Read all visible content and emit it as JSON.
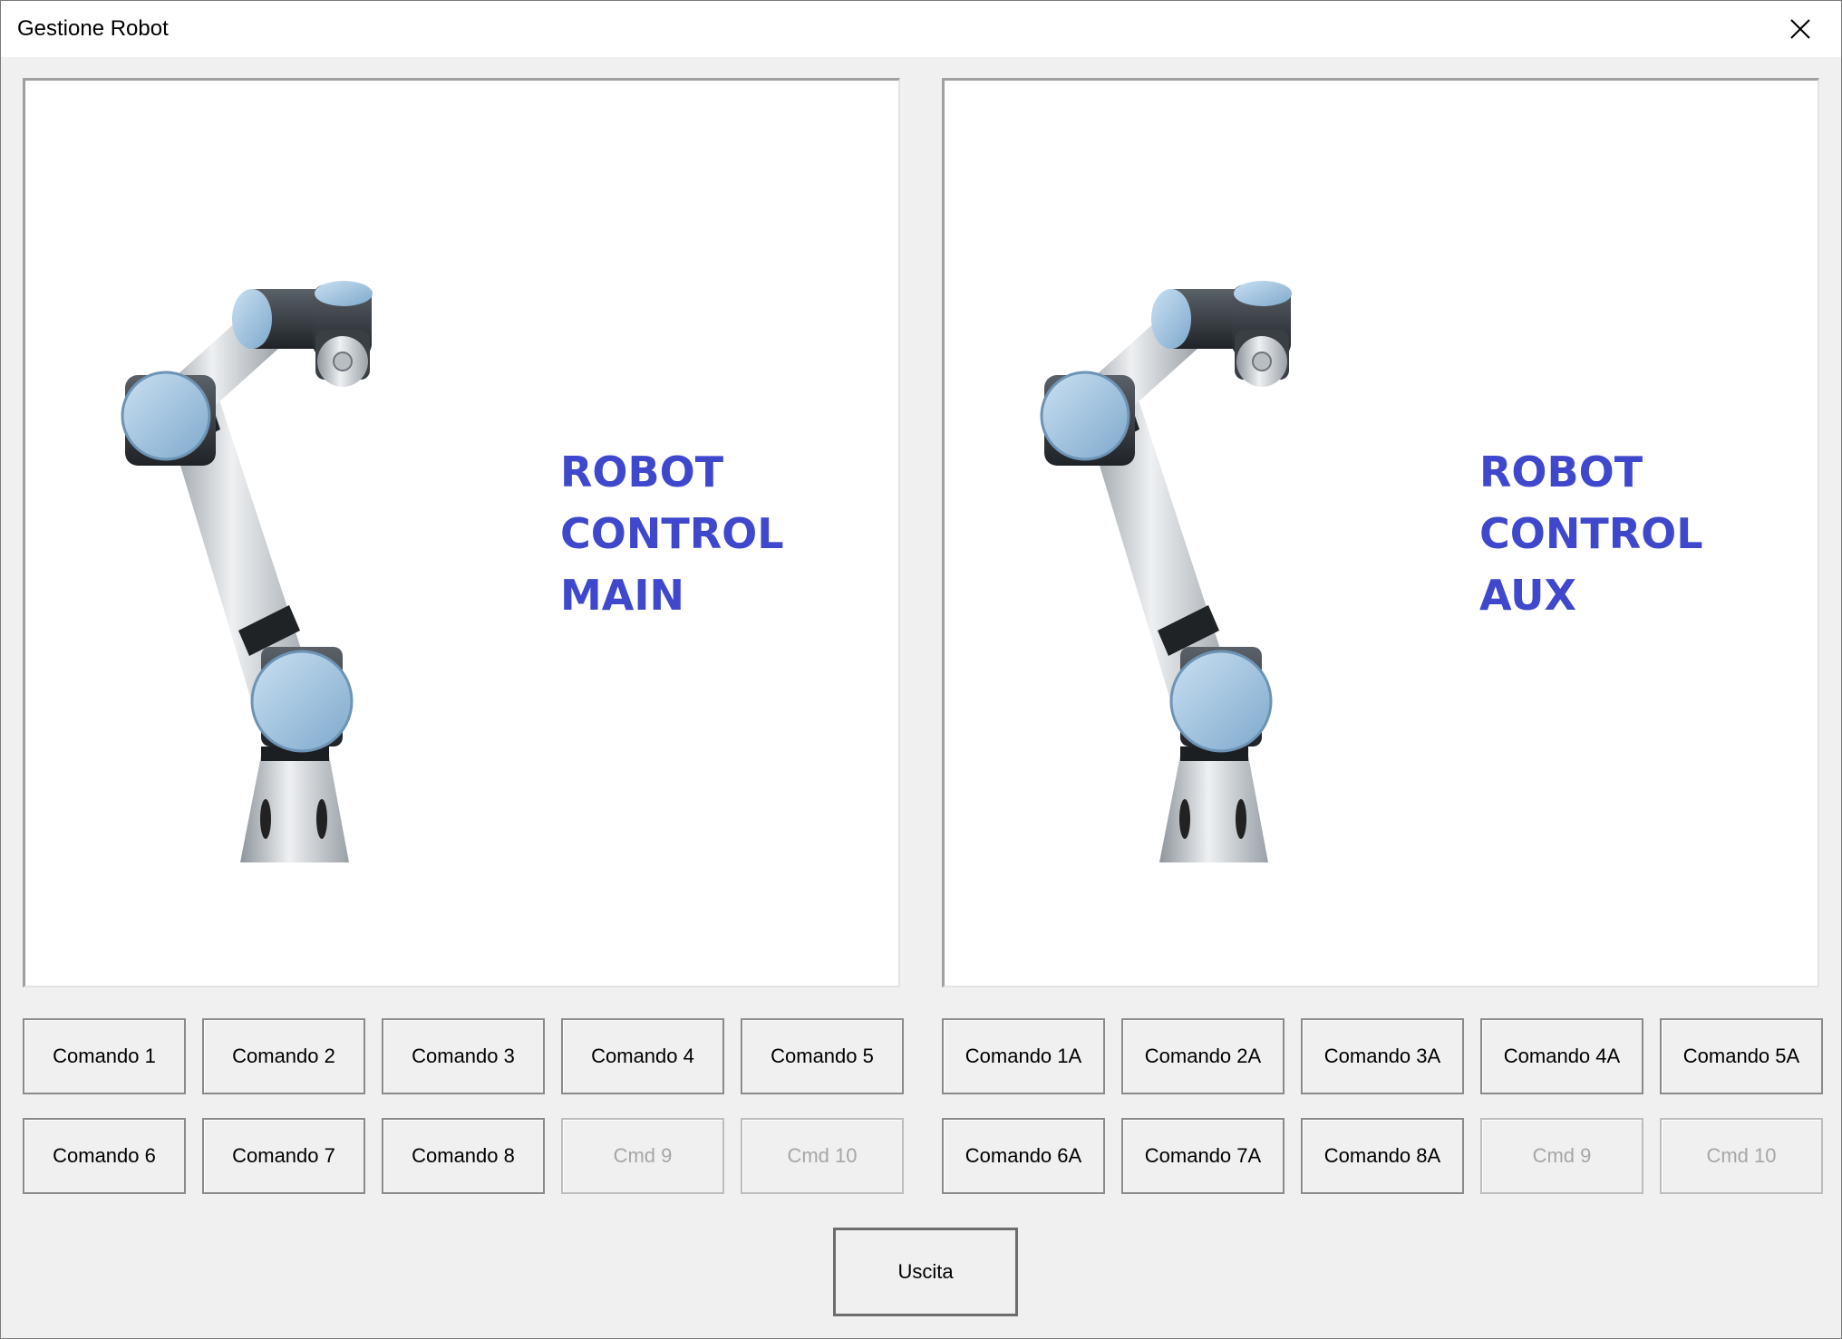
{
  "window": {
    "title": "Gestione Robot",
    "close_icon": "close-icon"
  },
  "panels": [
    {
      "label_lines": [
        "ROBOT",
        "CONTROL",
        "MAIN"
      ],
      "image": "robot-arm-image"
    },
    {
      "label_lines": [
        "ROBOT",
        "CONTROL",
        "AUX"
      ],
      "image": "robot-arm-image"
    }
  ],
  "colors": {
    "label": "#3f48cc",
    "joint_cap": "#a9cbe6",
    "joint_dark": "#2b2f33",
    "link_metal": "#c9ced3"
  },
  "buttons_main": [
    {
      "label": "Comando 1",
      "enabled": true
    },
    {
      "label": "Comando 2",
      "enabled": true
    },
    {
      "label": "Comando 3",
      "enabled": true
    },
    {
      "label": "Comando 4",
      "enabled": true
    },
    {
      "label": "Comando 5",
      "enabled": true
    },
    {
      "label": "Comando 6",
      "enabled": true
    },
    {
      "label": "Comando 7",
      "enabled": true
    },
    {
      "label": "Comando 8",
      "enabled": true
    },
    {
      "label": "Cmd 9",
      "enabled": false
    },
    {
      "label": "Cmd 10",
      "enabled": false
    }
  ],
  "buttons_aux": [
    {
      "label": "Comando 1A",
      "enabled": true
    },
    {
      "label": "Comando 2A",
      "enabled": true
    },
    {
      "label": "Comando 3A",
      "enabled": true
    },
    {
      "label": "Comando 4A",
      "enabled": true
    },
    {
      "label": "Comando 5A",
      "enabled": true
    },
    {
      "label": "Comando 6A",
      "enabled": true
    },
    {
      "label": "Comando 7A",
      "enabled": true
    },
    {
      "label": "Comando 8A",
      "enabled": true
    },
    {
      "label": "Cmd 9",
      "enabled": false
    },
    {
      "label": "Cmd 10",
      "enabled": false
    }
  ],
  "exit_button": {
    "label": "Uscita"
  }
}
